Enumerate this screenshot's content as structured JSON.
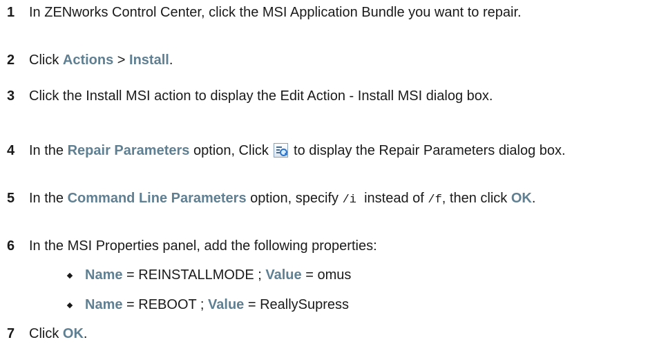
{
  "steps": [
    {
      "num": "1",
      "text": "In ZENworks Control Center, click the MSI Application Bundle you want to repair."
    },
    {
      "num": "2",
      "pre": "Click ",
      "ui1": "Actions",
      "sep": " > ",
      "ui2": "Install",
      "post": "."
    },
    {
      "num": "3",
      "text": "Click the Install MSI action to display the Edit Action - Install MSI dialog box."
    },
    {
      "num": "4",
      "pre": "In the ",
      "ui": "Repair Parameters",
      "mid": " option, Click ",
      "icon": "search-list-icon",
      "post": " to display the Repair Parameters dialog box."
    },
    {
      "num": "5",
      "pre": "In the ",
      "ui": "Command Line Parameters",
      "mid": " option, specify ",
      "code1": "/i",
      "mid2": "  instead of ",
      "code2": "/f",
      "mid3": ", then click ",
      "ok": "OK",
      "post": "."
    },
    {
      "num": "6",
      "text": "In the MSI Properties panel, add the following properties:"
    },
    {
      "num": "7",
      "pre": "Click ",
      "ok": "OK",
      "post": "."
    }
  ],
  "bullets": [
    {
      "name_label": "Name",
      "name_val": " = REINSTALLMODE ; ",
      "value_label": "Value",
      "value_val": " = omus"
    },
    {
      "name_label": "Name",
      "name_val": " = REBOOT ; ",
      "value_label": "Value",
      "value_val": " = ReallySupress"
    }
  ]
}
